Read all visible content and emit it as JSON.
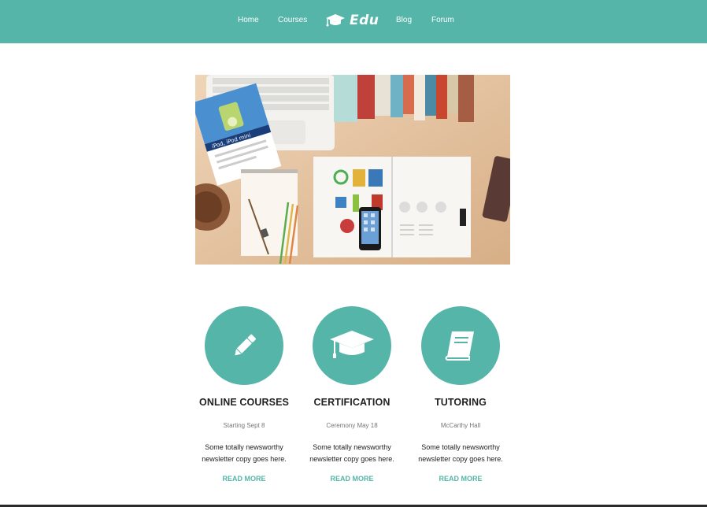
{
  "header": {
    "nav_left": [
      "Home",
      "Courses"
    ],
    "logo_text": "Edu",
    "nav_right": [
      "Blog",
      "Forum"
    ]
  },
  "hero": {
    "booklet_text": "iPod, iPod mini"
  },
  "features": [
    {
      "icon": "pencil-icon",
      "title": "ONLINE COURSES",
      "subtitle": "Starting Sept 8",
      "copy": "Some totally newsworthy newsletter copy goes here.",
      "link": "READ MORE"
    },
    {
      "icon": "graduation-cap-icon",
      "title": "CERTIFICATION",
      "subtitle": "Ceremony May 18",
      "copy": "Some totally newsworthy newsletter copy goes here.",
      "link": "READ MORE"
    },
    {
      "icon": "book-icon",
      "title": "TUTORING",
      "subtitle": "McCarthy Hall",
      "copy": "Some totally newsworthy newsletter copy goes here.",
      "link": "READ MORE"
    }
  ],
  "colors": {
    "brand": "#55b5a9",
    "text": "#222222",
    "muted": "#777777"
  }
}
